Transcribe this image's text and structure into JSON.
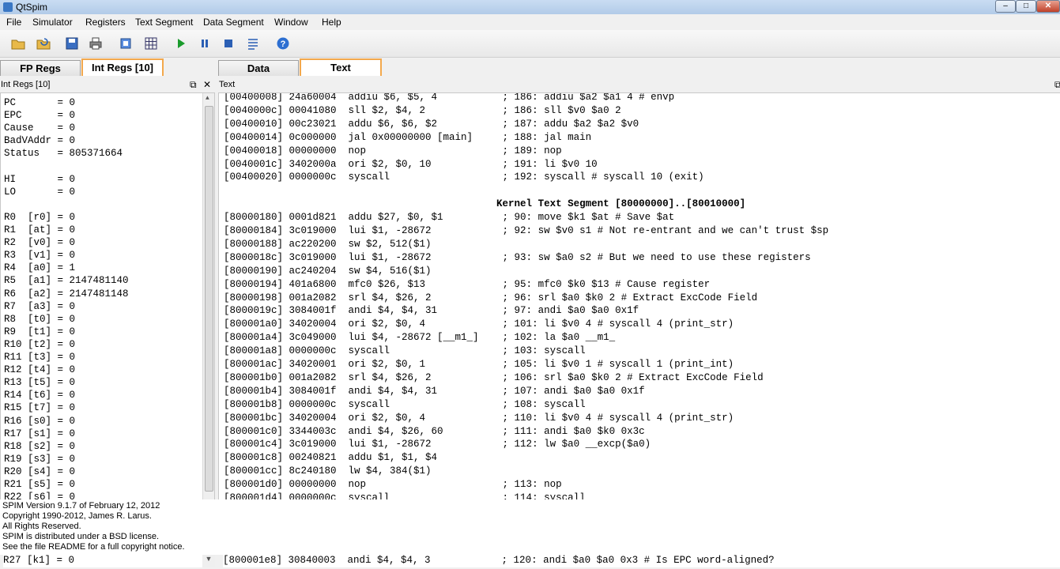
{
  "window": {
    "title": "QtSpim",
    "min": "–",
    "max": "□",
    "close": "✕"
  },
  "menu": [
    "File",
    "Simulator",
    "Registers",
    "Text Segment",
    "Data Segment",
    "Window",
    "Help"
  ],
  "toolbar_icons": [
    "open-file-icon",
    "reload-file-icon",
    "save-log-icon",
    "print-icon",
    "clear-registers-icon",
    "grid-icon",
    "run-icon",
    "pause-icon",
    "stop-icon",
    "step-icon",
    "help-icon"
  ],
  "left_tabs": [
    {
      "label": "FP Regs",
      "active": false
    },
    {
      "label": "Int Regs [10]",
      "active": true
    }
  ],
  "right_tabs": [
    {
      "label": "Data",
      "active": false
    },
    {
      "label": "Text",
      "active": true
    }
  ],
  "left_dock_title": "Int Regs [10]",
  "right_dock_title": "Text",
  "registers": [
    "PC       = 0",
    "EPC      = 0",
    "Cause    = 0",
    "BadVAddr = 0",
    "Status   = 805371664",
    "",
    "HI       = 0",
    "LO       = 0",
    "",
    "R0  [r0] = 0",
    "R1  [at] = 0",
    "R2  [v0] = 0",
    "R3  [v1] = 0",
    "R4  [a0] = 1",
    "R5  [a1] = 2147481140",
    "R6  [a2] = 2147481148",
    "R7  [a3] = 0",
    "R8  [t0] = 0",
    "R9  [t1] = 0",
    "R10 [t2] = 0",
    "R11 [t3] = 0",
    "R12 [t4] = 0",
    "R13 [t5] = 0",
    "R14 [t6] = 0",
    "R15 [t7] = 0",
    "R16 [s0] = 0",
    "R17 [s1] = 0",
    "R18 [s2] = 0",
    "R19 [s3] = 0",
    "R20 [s4] = 0",
    "R21 [s5] = 0",
    "R22 [s6] = 0"
  ],
  "register_bottom": "R27 [k1] = 0",
  "text_lines": [
    "[00400008] 24a60004  addiu $6, $5, 4           ; 186: addiu $a2 $a1 4 # envp",
    "[0040000c] 00041080  sll $2, $4, 2             ; 186: sll $v0 $a0 2",
    "[00400010] 00c23021  addu $6, $6, $2           ; 187: addu $a2 $a2 $v0",
    "[00400014] 0c000000  jal 0x00000000 [main]     ; 188: jal main",
    "[00400018] 00000000  nop                       ; 189: nop",
    "[0040001c] 3402000a  ori $2, $0, 10            ; 191: li $v0 10",
    "[00400020] 0000000c  syscall                   ; 192: syscall # syscall 10 (exit)",
    "",
    "                                              Kernel Text Segment [80000000]..[80010000]",
    "[80000180] 0001d821  addu $27, $0, $1          ; 90: move $k1 $at # Save $at",
    "[80000184] 3c019000  lui $1, -28672            ; 92: sw $v0 s1 # Not re-entrant and we can't trust $sp",
    "[80000188] ac220200  sw $2, 512($1)",
    "[8000018c] 3c019000  lui $1, -28672            ; 93: sw $a0 s2 # But we need to use these registers",
    "[80000190] ac240204  sw $4, 516($1)",
    "[80000194] 401a6800  mfc0 $26, $13             ; 95: mfc0 $k0 $13 # Cause register",
    "[80000198] 001a2082  srl $4, $26, 2            ; 96: srl $a0 $k0 2 # Extract ExcCode Field",
    "[8000019c] 3084001f  andi $4, $4, 31           ; 97: andi $a0 $a0 0x1f",
    "[800001a0] 34020004  ori $2, $0, 4             ; 101: li $v0 4 # syscall 4 (print_str)",
    "[800001a4] 3c049000  lui $4, -28672 [__m1_]    ; 102: la $a0 __m1_",
    "[800001a8] 0000000c  syscall                   ; 103: syscall",
    "[800001ac] 34020001  ori $2, $0, 1             ; 105: li $v0 1 # syscall 1 (print_int)",
    "[800001b0] 001a2082  srl $4, $26, 2            ; 106: srl $a0 $k0 2 # Extract ExcCode Field",
    "[800001b4] 3084001f  andi $4, $4, 31           ; 107: andi $a0 $a0 0x1f",
    "[800001b8] 0000000c  syscall                   ; 108: syscall",
    "[800001bc] 34020004  ori $2, $0, 4             ; 110: li $v0 4 # syscall 4 (print_str)",
    "[800001c0] 3344003c  andi $4, $26, 60          ; 111: andi $a0 $k0 0x3c",
    "[800001c4] 3c019000  lui $1, -28672            ; 112: lw $a0 __excp($a0)",
    "[800001c8] 00240821  addu $1, $1, $4",
    "[800001cc] 8c240180  lw $4, 384($1)",
    "[800001d0] 00000000  nop                       ; 113: nop",
    "[800001d4] 0000000c  syscall                   ; 114: syscall"
  ],
  "text_bottom": "[800001e8] 30840003  andi $4, $4, 3            ; 120: andi $a0 $a0 0x3 # Is EPC word-aligned?",
  "messages": [
    "SPIM Version 9.1.7 of February 12, 2012",
    "Copyright 1990-2012, James R. Larus.",
    "All Rights Reserved.",
    "SPIM is distributed under a BSD license.",
    "See the file README for a full copyright notice."
  ],
  "colors": {
    "accent_tab": "#f3a84c",
    "title_bg": "#c0d6f0"
  }
}
